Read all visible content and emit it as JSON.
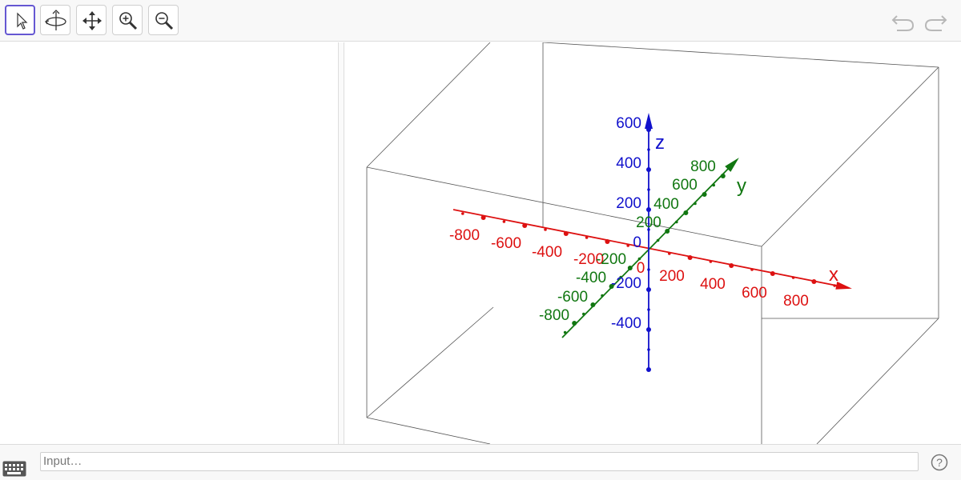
{
  "toolbar": {
    "tools": [
      {
        "name": "move-tool",
        "icon": "cursor-arrow-icon",
        "active": true
      },
      {
        "name": "rotate-3d-view-tool",
        "icon": "rotate-3d-icon",
        "active": false
      },
      {
        "name": "move-graphics-view-tool",
        "icon": "four-way-arrow-icon",
        "active": false
      },
      {
        "name": "zoom-in-tool",
        "icon": "zoom-in-icon",
        "active": false
      },
      {
        "name": "zoom-out-tool",
        "icon": "zoom-out-icon",
        "active": false
      }
    ],
    "undo_icon": "undo-icon",
    "redo_icon": "redo-icon"
  },
  "graphics3d": {
    "colors": {
      "x": "#dd1111",
      "y": "#117711",
      "z": "#1111cc",
      "box": "#555555"
    },
    "x_axis": {
      "label": "x",
      "ticks": [
        "-800",
        "-600",
        "-400",
        "-200",
        "0",
        "200",
        "400",
        "600",
        "800"
      ]
    },
    "y_axis": {
      "label": "y",
      "ticks": [
        "-800",
        "-600",
        "-400",
        "-200",
        "200",
        "400",
        "600",
        "800"
      ]
    },
    "z_axis": {
      "label": "z",
      "ticks": [
        "-400",
        "-200",
        "0",
        "200",
        "400",
        "600"
      ]
    }
  },
  "input_bar": {
    "placeholder": "Input…",
    "keyboard_icon": "keyboard-icon",
    "help_icon": "help-icon",
    "help_glyph": "?"
  }
}
